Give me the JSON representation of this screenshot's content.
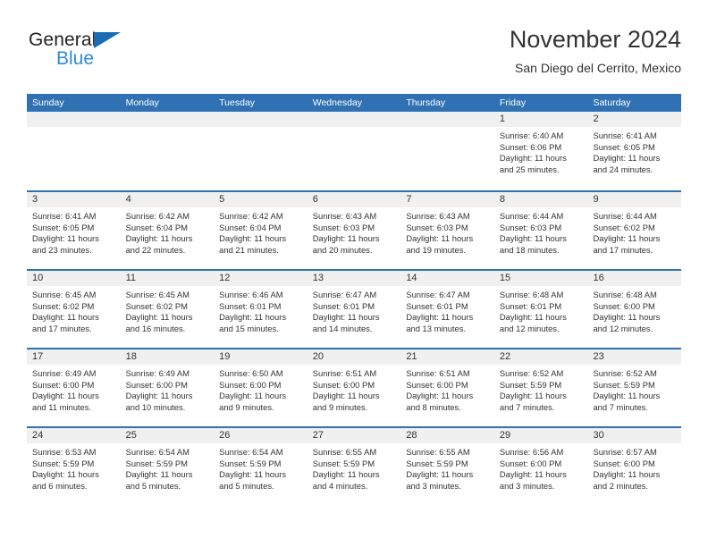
{
  "brand": {
    "name_part1": "General",
    "name_part2": "Blue",
    "color_dark": "#231f20",
    "color_blue": "#2e8bd6",
    "triangle_color": "#1b6cb3"
  },
  "header": {
    "title": "November 2024",
    "subtitle": "San Diego del Cerrito, Mexico"
  },
  "theme": {
    "header_blue": "#3071b4",
    "day_band_gray": "#f0f0f0",
    "text_color": "#333333"
  },
  "weekdays": [
    "Sunday",
    "Monday",
    "Tuesday",
    "Wednesday",
    "Thursday",
    "Friday",
    "Saturday"
  ],
  "labels": {
    "sunrise_prefix": "Sunrise:",
    "sunset_prefix": "Sunset:",
    "daylight_prefix": "Daylight:"
  },
  "weeks": [
    [
      {
        "day": "",
        "sunrise": "",
        "sunset": "",
        "daylight_l1": "",
        "daylight_l2": ""
      },
      {
        "day": "",
        "sunrise": "",
        "sunset": "",
        "daylight_l1": "",
        "daylight_l2": ""
      },
      {
        "day": "",
        "sunrise": "",
        "sunset": "",
        "daylight_l1": "",
        "daylight_l2": ""
      },
      {
        "day": "",
        "sunrise": "",
        "sunset": "",
        "daylight_l1": "",
        "daylight_l2": ""
      },
      {
        "day": "",
        "sunrise": "",
        "sunset": "",
        "daylight_l1": "",
        "daylight_l2": ""
      },
      {
        "day": "1",
        "sunrise": "Sunrise: 6:40 AM",
        "sunset": "Sunset: 6:06 PM",
        "daylight_l1": "Daylight: 11 hours",
        "daylight_l2": "and 25 minutes."
      },
      {
        "day": "2",
        "sunrise": "Sunrise: 6:41 AM",
        "sunset": "Sunset: 6:05 PM",
        "daylight_l1": "Daylight: 11 hours",
        "daylight_l2": "and 24 minutes."
      }
    ],
    [
      {
        "day": "3",
        "sunrise": "Sunrise: 6:41 AM",
        "sunset": "Sunset: 6:05 PM",
        "daylight_l1": "Daylight: 11 hours",
        "daylight_l2": "and 23 minutes."
      },
      {
        "day": "4",
        "sunrise": "Sunrise: 6:42 AM",
        "sunset": "Sunset: 6:04 PM",
        "daylight_l1": "Daylight: 11 hours",
        "daylight_l2": "and 22 minutes."
      },
      {
        "day": "5",
        "sunrise": "Sunrise: 6:42 AM",
        "sunset": "Sunset: 6:04 PM",
        "daylight_l1": "Daylight: 11 hours",
        "daylight_l2": "and 21 minutes."
      },
      {
        "day": "6",
        "sunrise": "Sunrise: 6:43 AM",
        "sunset": "Sunset: 6:03 PM",
        "daylight_l1": "Daylight: 11 hours",
        "daylight_l2": "and 20 minutes."
      },
      {
        "day": "7",
        "sunrise": "Sunrise: 6:43 AM",
        "sunset": "Sunset: 6:03 PM",
        "daylight_l1": "Daylight: 11 hours",
        "daylight_l2": "and 19 minutes."
      },
      {
        "day": "8",
        "sunrise": "Sunrise: 6:44 AM",
        "sunset": "Sunset: 6:03 PM",
        "daylight_l1": "Daylight: 11 hours",
        "daylight_l2": "and 18 minutes."
      },
      {
        "day": "9",
        "sunrise": "Sunrise: 6:44 AM",
        "sunset": "Sunset: 6:02 PM",
        "daylight_l1": "Daylight: 11 hours",
        "daylight_l2": "and 17 minutes."
      }
    ],
    [
      {
        "day": "10",
        "sunrise": "Sunrise: 6:45 AM",
        "sunset": "Sunset: 6:02 PM",
        "daylight_l1": "Daylight: 11 hours",
        "daylight_l2": "and 17 minutes."
      },
      {
        "day": "11",
        "sunrise": "Sunrise: 6:45 AM",
        "sunset": "Sunset: 6:02 PM",
        "daylight_l1": "Daylight: 11 hours",
        "daylight_l2": "and 16 minutes."
      },
      {
        "day": "12",
        "sunrise": "Sunrise: 6:46 AM",
        "sunset": "Sunset: 6:01 PM",
        "daylight_l1": "Daylight: 11 hours",
        "daylight_l2": "and 15 minutes."
      },
      {
        "day": "13",
        "sunrise": "Sunrise: 6:47 AM",
        "sunset": "Sunset: 6:01 PM",
        "daylight_l1": "Daylight: 11 hours",
        "daylight_l2": "and 14 minutes."
      },
      {
        "day": "14",
        "sunrise": "Sunrise: 6:47 AM",
        "sunset": "Sunset: 6:01 PM",
        "daylight_l1": "Daylight: 11 hours",
        "daylight_l2": "and 13 minutes."
      },
      {
        "day": "15",
        "sunrise": "Sunrise: 6:48 AM",
        "sunset": "Sunset: 6:01 PM",
        "daylight_l1": "Daylight: 11 hours",
        "daylight_l2": "and 12 minutes."
      },
      {
        "day": "16",
        "sunrise": "Sunrise: 6:48 AM",
        "sunset": "Sunset: 6:00 PM",
        "daylight_l1": "Daylight: 11 hours",
        "daylight_l2": "and 12 minutes."
      }
    ],
    [
      {
        "day": "17",
        "sunrise": "Sunrise: 6:49 AM",
        "sunset": "Sunset: 6:00 PM",
        "daylight_l1": "Daylight: 11 hours",
        "daylight_l2": "and 11 minutes."
      },
      {
        "day": "18",
        "sunrise": "Sunrise: 6:49 AM",
        "sunset": "Sunset: 6:00 PM",
        "daylight_l1": "Daylight: 11 hours",
        "daylight_l2": "and 10 minutes."
      },
      {
        "day": "19",
        "sunrise": "Sunrise: 6:50 AM",
        "sunset": "Sunset: 6:00 PM",
        "daylight_l1": "Daylight: 11 hours",
        "daylight_l2": "and 9 minutes."
      },
      {
        "day": "20",
        "sunrise": "Sunrise: 6:51 AM",
        "sunset": "Sunset: 6:00 PM",
        "daylight_l1": "Daylight: 11 hours",
        "daylight_l2": "and 9 minutes."
      },
      {
        "day": "21",
        "sunrise": "Sunrise: 6:51 AM",
        "sunset": "Sunset: 6:00 PM",
        "daylight_l1": "Daylight: 11 hours",
        "daylight_l2": "and 8 minutes."
      },
      {
        "day": "22",
        "sunrise": "Sunrise: 6:52 AM",
        "sunset": "Sunset: 5:59 PM",
        "daylight_l1": "Daylight: 11 hours",
        "daylight_l2": "and 7 minutes."
      },
      {
        "day": "23",
        "sunrise": "Sunrise: 6:52 AM",
        "sunset": "Sunset: 5:59 PM",
        "daylight_l1": "Daylight: 11 hours",
        "daylight_l2": "and 7 minutes."
      }
    ],
    [
      {
        "day": "24",
        "sunrise": "Sunrise: 6:53 AM",
        "sunset": "Sunset: 5:59 PM",
        "daylight_l1": "Daylight: 11 hours",
        "daylight_l2": "and 6 minutes."
      },
      {
        "day": "25",
        "sunrise": "Sunrise: 6:54 AM",
        "sunset": "Sunset: 5:59 PM",
        "daylight_l1": "Daylight: 11 hours",
        "daylight_l2": "and 5 minutes."
      },
      {
        "day": "26",
        "sunrise": "Sunrise: 6:54 AM",
        "sunset": "Sunset: 5:59 PM",
        "daylight_l1": "Daylight: 11 hours",
        "daylight_l2": "and 5 minutes."
      },
      {
        "day": "27",
        "sunrise": "Sunrise: 6:55 AM",
        "sunset": "Sunset: 5:59 PM",
        "daylight_l1": "Daylight: 11 hours",
        "daylight_l2": "and 4 minutes."
      },
      {
        "day": "28",
        "sunrise": "Sunrise: 6:55 AM",
        "sunset": "Sunset: 5:59 PM",
        "daylight_l1": "Daylight: 11 hours",
        "daylight_l2": "and 3 minutes."
      },
      {
        "day": "29",
        "sunrise": "Sunrise: 6:56 AM",
        "sunset": "Sunset: 6:00 PM",
        "daylight_l1": "Daylight: 11 hours",
        "daylight_l2": "and 3 minutes."
      },
      {
        "day": "30",
        "sunrise": "Sunrise: 6:57 AM",
        "sunset": "Sunset: 6:00 PM",
        "daylight_l1": "Daylight: 11 hours",
        "daylight_l2": "and 2 minutes."
      }
    ]
  ]
}
